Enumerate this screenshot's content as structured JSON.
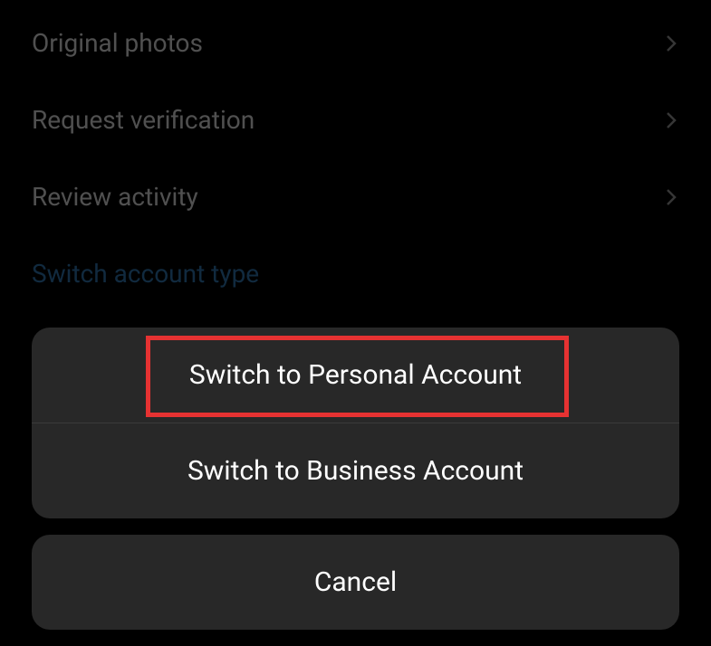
{
  "settings": {
    "items": [
      {
        "label": "Original photos",
        "hasChevron": true
      },
      {
        "label": "Request verification",
        "hasChevron": true
      },
      {
        "label": "Review activity",
        "hasChevron": true
      }
    ],
    "switchAccountTypeLabel": "Switch account type"
  },
  "actionSheet": {
    "options": [
      {
        "label": "Switch to Personal Account",
        "highlighted": true
      },
      {
        "label": "Switch to Business Account",
        "highlighted": false
      }
    ],
    "cancelLabel": "Cancel"
  }
}
